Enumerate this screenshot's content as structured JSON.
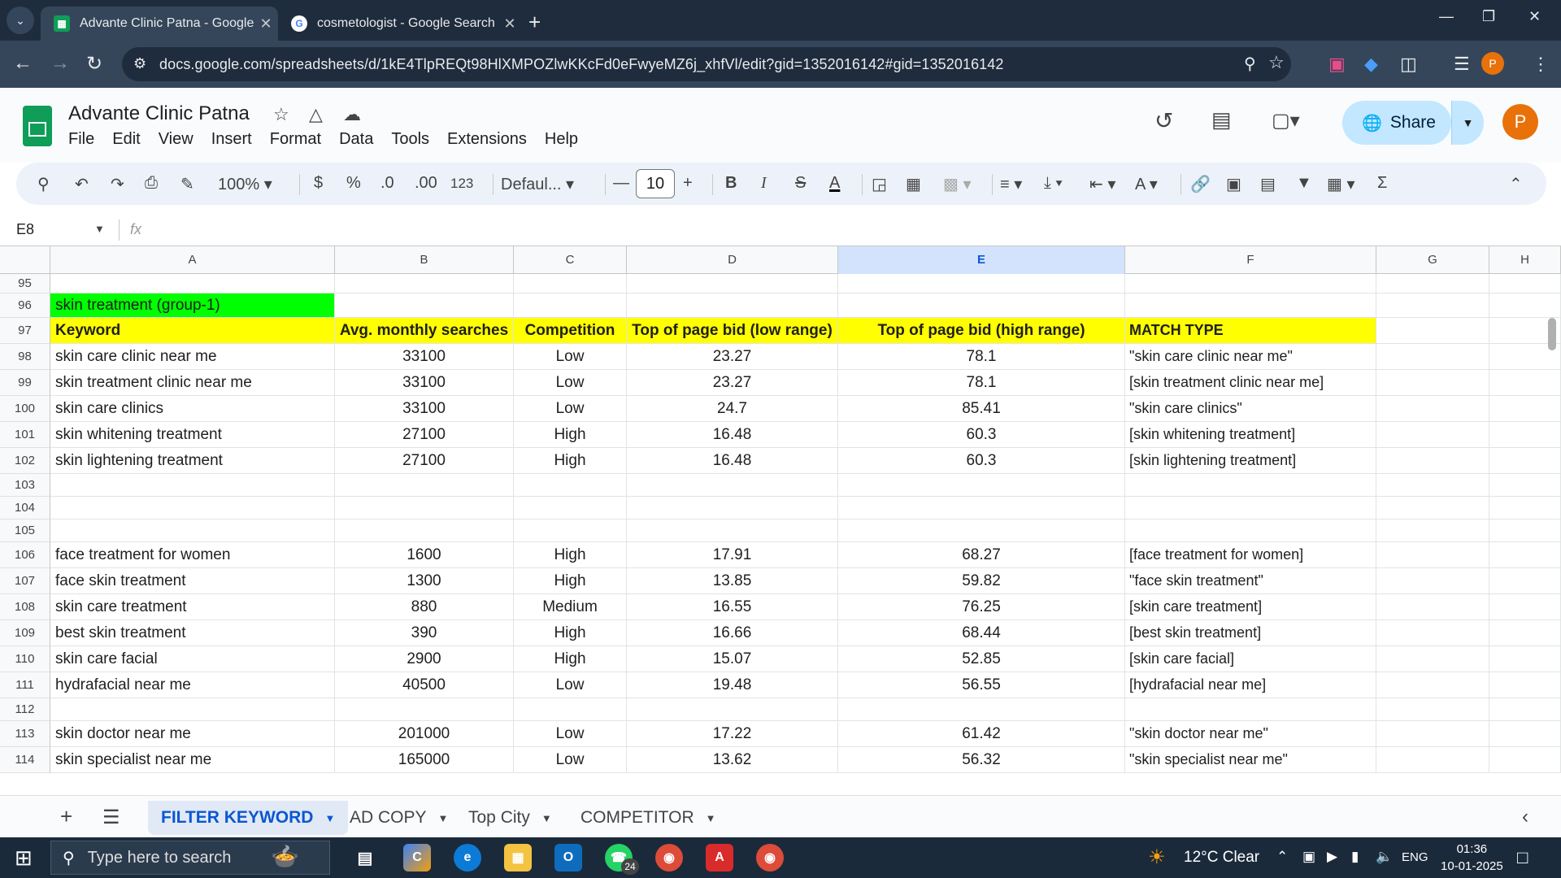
{
  "browser": {
    "tabs": [
      {
        "title": "Advante Clinic Patna - Google S",
        "active": true,
        "favicon": "sheets-icon"
      },
      {
        "title": "cosmetologist - Google Search",
        "active": false,
        "favicon": "google-icon"
      }
    ],
    "url": "docs.google.com/spreadsheets/d/1kE4TlpREQt98HlXMPOZlwKKcFd0eFwyeMZ6j_xhfVl/edit?gid=1352016142#gid=1352016142",
    "profile_initial": "P"
  },
  "app": {
    "title": "Advante Clinic Patna",
    "menus": [
      "File",
      "Edit",
      "View",
      "Insert",
      "Format",
      "Data",
      "Tools",
      "Extensions",
      "Help"
    ],
    "share_label": "Share",
    "avatar_initial": "P",
    "accent": "#0b57d0",
    "logo_color": "#0f9d58"
  },
  "toolbar": {
    "zoom": "100%",
    "currency": "$",
    "percent": "%",
    "dec_decrease": ".0",
    "dec_increase": ".00",
    "number_format": "123",
    "font": "Defaul...",
    "font_size": "10"
  },
  "formula_bar": {
    "name_box": "E8",
    "fx": "fx",
    "value": ""
  },
  "sheet": {
    "columns": [
      "A",
      "B",
      "C",
      "D",
      "E",
      "F",
      "G",
      "H"
    ],
    "selected_column": "E",
    "rows": [
      {
        "n": "95",
        "cells": [
          "",
          "",
          "",
          "",
          "",
          ""
        ]
      },
      {
        "n": "96",
        "cells": [
          "skin treatment (group-1)",
          "",
          "",
          "",
          "",
          ""
        ]
      },
      {
        "n": "97",
        "cells": [
          "Keyword",
          "Avg. monthly searches",
          "Competition",
          "Top of page bid (low range)",
          "Top of page bid (high range)",
          "MATCH TYPE"
        ]
      },
      {
        "n": "98",
        "cells": [
          "skin care clinic near me",
          "33100",
          "Low",
          "23.27",
          "78.1",
          "\"skin care clinic near me\""
        ]
      },
      {
        "n": "99",
        "cells": [
          "skin treatment clinic near me",
          "33100",
          "Low",
          "23.27",
          "78.1",
          "[skin treatment clinic near me]"
        ]
      },
      {
        "n": "100",
        "cells": [
          "skin care clinics",
          "33100",
          "Low",
          "24.7",
          "85.41",
          "\"skin care clinics\""
        ]
      },
      {
        "n": "101",
        "cells": [
          "skin whitening treatment",
          "27100",
          "High",
          "16.48",
          "60.3",
          "[skin whitening treatment]"
        ]
      },
      {
        "n": "102",
        "cells": [
          "skin lightening treatment",
          "27100",
          "High",
          "16.48",
          "60.3",
          "[skin lightening treatment]"
        ]
      },
      {
        "n": "103",
        "cells": [
          "",
          "",
          "",
          "",
          "",
          ""
        ]
      },
      {
        "n": "104",
        "cells": [
          "",
          "",
          "",
          "",
          "",
          ""
        ]
      },
      {
        "n": "105",
        "cells": [
          "",
          "",
          "",
          "",
          "",
          ""
        ]
      },
      {
        "n": "106",
        "cells": [
          "face treatment for women",
          "1600",
          "High",
          "17.91",
          "68.27",
          "[face treatment for women]"
        ]
      },
      {
        "n": "107",
        "cells": [
          "face skin treatment",
          "1300",
          "High",
          "13.85",
          "59.82",
          "\"face skin treatment\""
        ]
      },
      {
        "n": "108",
        "cells": [
          "skin care treatment",
          "880",
          "Medium",
          "16.55",
          "76.25",
          "[skin care treatment]"
        ]
      },
      {
        "n": "109",
        "cells": [
          "best skin treatment",
          "390",
          "High",
          "16.66",
          "68.44",
          "[best skin treatment]"
        ]
      },
      {
        "n": "110",
        "cells": [
          "skin care facial",
          "2900",
          "High",
          "15.07",
          "52.85",
          "[skin care facial]"
        ]
      },
      {
        "n": "111",
        "cells": [
          "hydrafacial near me",
          "40500",
          "Low",
          "19.48",
          "56.55",
          "[hydrafacial near me]"
        ]
      },
      {
        "n": "112",
        "cells": [
          "",
          "",
          "",
          "",
          "",
          ""
        ]
      },
      {
        "n": "113",
        "cells": [
          "skin doctor near me",
          "201000",
          "Low",
          "17.22",
          "61.42",
          "\"skin doctor near me\""
        ]
      },
      {
        "n": "114",
        "cells": [
          "skin specialist near me",
          "165000",
          "Low",
          "13.62",
          "56.32",
          "\"skin specialist near me\""
        ]
      }
    ],
    "colors": {
      "group_fill": "#00ff00",
      "header_fill": "#ffff00"
    }
  },
  "sheet_tabs": [
    {
      "label": "FILTER KEYWORD",
      "active": true
    },
    {
      "label": "AD COPY",
      "active": false
    },
    {
      "label": "Top City",
      "active": false
    },
    {
      "label": "COMPETITOR",
      "active": false
    }
  ],
  "taskbar": {
    "search_placeholder": "Type here to search",
    "whatsapp_badge": "24",
    "weather": "12°C  Clear",
    "language": "ENG",
    "time": "01:36",
    "date": "10-01-2025"
  }
}
